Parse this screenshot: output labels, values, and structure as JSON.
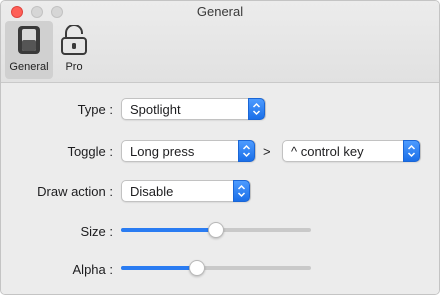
{
  "window": {
    "title": "General",
    "accent_color": "#2a7cf2",
    "close_color": "#fe5f57"
  },
  "toolbar": {
    "items": [
      {
        "label": "General",
        "icon": "toggle-switch-icon",
        "selected": true
      },
      {
        "label": "Pro",
        "icon": "unlocked-padlock-icon",
        "selected": false
      }
    ]
  },
  "settings": {
    "type": {
      "label": "Type :",
      "value": "Spotlight"
    },
    "toggle": {
      "label": "Toggle :",
      "value": "Long press",
      "separator": ">",
      "key_value": "^ control key"
    },
    "draw_action": {
      "label": "Draw action :",
      "value": "Disable"
    },
    "size": {
      "label": "Size :",
      "fraction": 0.5
    },
    "alpha": {
      "label": "Alpha :",
      "fraction": 0.4
    }
  }
}
